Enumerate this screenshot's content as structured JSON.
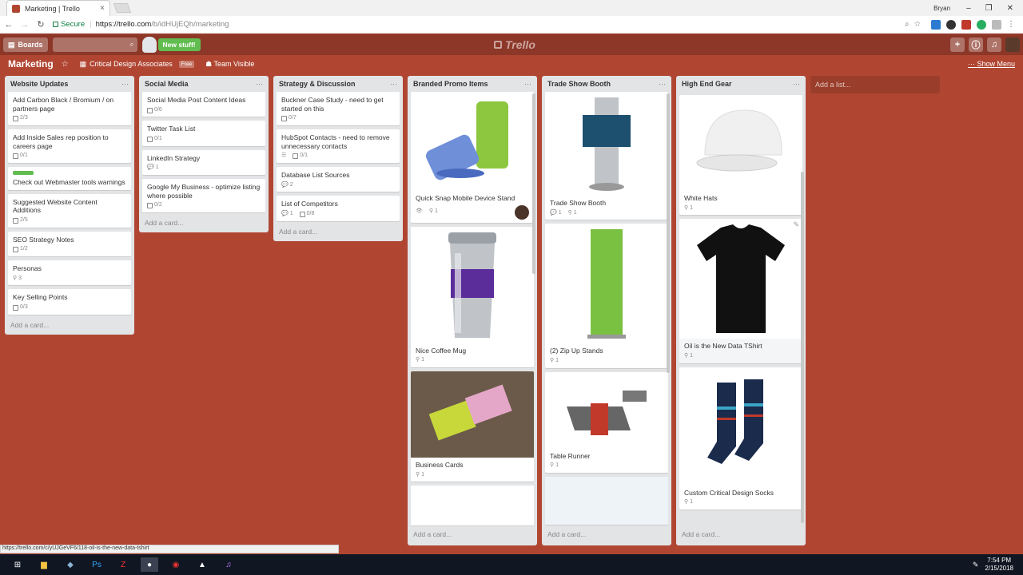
{
  "browser": {
    "tab_title": "Marketing | Trello",
    "secure_label": "Secure",
    "url_host": "https://trello.com",
    "url_path": "/b/idHUjEQh/marketing",
    "user": "Bryan"
  },
  "header": {
    "boards_label": "Boards",
    "new_stuff": "New stuff!",
    "logo": "Trello"
  },
  "board": {
    "title": "Marketing",
    "team": "Critical Design Associates",
    "team_badge": "Free",
    "visibility": "Team Visible",
    "show_menu": "Show Menu",
    "add_list": "Add a list..."
  },
  "lists": [
    {
      "title": "Website Updates",
      "add_card": "Add a card...",
      "cards": [
        {
          "title": "Add Carbon Black / Bromium / on partners page",
          "checklist": "2/3"
        },
        {
          "title": "Add Inside Sales rep position to careers page",
          "checklist": "0/1"
        },
        {
          "title": "Check out Webmaster tools warnings"
        },
        {
          "title": "Suggested Website Content Additions",
          "checklist": "2/5"
        },
        {
          "title": "SEO Strategy Notes",
          "checklist": "1/2"
        },
        {
          "title": "Personas",
          "attachments": "3"
        },
        {
          "title": "Key Selling Points",
          "checklist": "0/3"
        }
      ]
    },
    {
      "title": "Social Media",
      "add_card": "Add a card...",
      "cards": [
        {
          "title": "Social Media Post Content Ideas",
          "checklist": "0/6"
        },
        {
          "title": "Twitter Task List",
          "checklist": "0/1"
        },
        {
          "title": "LinkedIn Strategy",
          "comments": "1"
        },
        {
          "title": "Google My Business - optimize listing where possible",
          "checklist": "0/2"
        }
      ]
    },
    {
      "title": "Strategy & Discussion",
      "add_card": "Add a card...",
      "cards": [
        {
          "title": "Buckner Case Study - need to get started on this",
          "checklist": "0/7"
        },
        {
          "title": "HubSpot Contacts - need to remove unnecessary contacts",
          "checklist": "0/1"
        },
        {
          "title": "Database List Sources",
          "comments": "2"
        },
        {
          "title": "List of Competitors",
          "comments": "1",
          "checklist": "0/8"
        }
      ]
    },
    {
      "title": "Branded Promo Items",
      "add_card": "Add a card...",
      "cards": [
        {
          "title": "Quick Snap Mobile Device Stand",
          "attachments": "1"
        },
        {
          "title": "Nice Coffee Mug",
          "attachments": "1"
        },
        {
          "title": "Business Cards",
          "attachments": "1"
        }
      ]
    },
    {
      "title": "Trade Show Booth",
      "add_card": "Add a card...",
      "cards": [
        {
          "title": "Trade Show Booth",
          "comments": "1",
          "attachments": "1"
        },
        {
          "title": "(2) Zip Up Stands",
          "attachments": "1"
        },
        {
          "title": "Table Runner",
          "attachments": "1"
        }
      ]
    },
    {
      "title": "High End Gear",
      "add_card": "Add a card...",
      "cards": [
        {
          "title": "White Hats",
          "attachments": "1"
        },
        {
          "title": "Oil is the New Data TShirt",
          "attachments": "1"
        },
        {
          "title": "Custom Critical Design Socks",
          "attachments": "1"
        }
      ]
    }
  ],
  "status_url": "https://trello.com/c/yUJGeVF6/118-oil-is-the-new-data-tshirt",
  "clock": {
    "time": "7:54 PM",
    "date": "2/15/2018"
  },
  "colors": {
    "board_bg": "#b04632",
    "header_bg": "#8c3728",
    "label_green": "#61bd4f"
  }
}
